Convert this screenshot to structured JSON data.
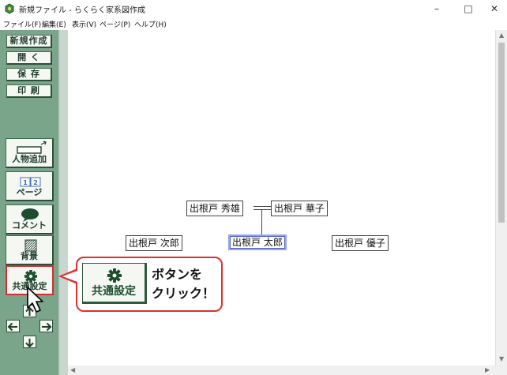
{
  "window": {
    "title": "新規ファイル - らくらく家系図作成",
    "controls": {
      "minimize": "–",
      "maximize": "□",
      "close": "✕"
    }
  },
  "menu": [
    "ファイル(F)",
    "編集(E)",
    "表示(V)",
    "ページ(P)",
    "ヘルプ(H)"
  ],
  "toolbar": {
    "new": "新規作成",
    "open": "開 く",
    "save": "保 存",
    "print": "印 刷",
    "add_person": "人物追加",
    "page": "ページ",
    "page_icon_numbers": [
      "1",
      "2"
    ],
    "comment": "コメント",
    "background": "背景",
    "common_settings": "共通設定"
  },
  "icons": {
    "zoom_in": "zoom-in-icon",
    "zoom_out": "zoom-out-icon",
    "gear": "gear-icon",
    "arrows": [
      "arrow-up-icon",
      "arrow-left-icon",
      "arrow-right-icon",
      "arrow-down-icon"
    ]
  },
  "tree": {
    "people": [
      "出根戸 秀雄",
      "出根戸 華子",
      "出根戸 次郎",
      "出根戸 太郎",
      "出根戸 優子"
    ],
    "selected": "出根戸 太郎"
  },
  "callout": {
    "button_label": "共通設定",
    "line1": "ボタンを",
    "line2": "クリック！"
  },
  "colors": {
    "sidebar": "#7aa58a",
    "button_text": "#1e3d2b",
    "callout_border": "#e03030",
    "selection": "#5060c8"
  }
}
